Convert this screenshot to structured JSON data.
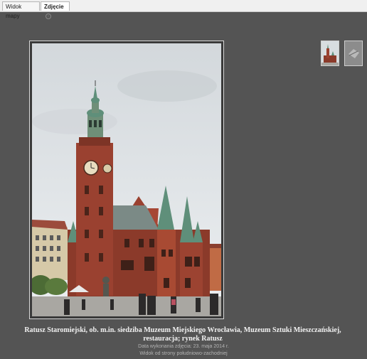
{
  "tabs": {
    "map_label": "Widok mapy",
    "photo_label": "Zdjęcie",
    "close_symbol": "x"
  },
  "photo": {
    "caption": "Ratusz Staromiejski, ob. m.in. siedziba Muzeum Miejskiego Wrocławia, Muzeum Sztuki Mieszczańskiej, restauracja; rynek Ratusz",
    "date": "Data wykonania zdjęcia: 23. maja 2014 r.",
    "description": "Widok od strony południowo-zachodniej"
  },
  "colors": {
    "background": "#545454",
    "brick": "#8b3a2a",
    "roof_green": "#5f8f7a",
    "sky": "#dfe3e6"
  }
}
